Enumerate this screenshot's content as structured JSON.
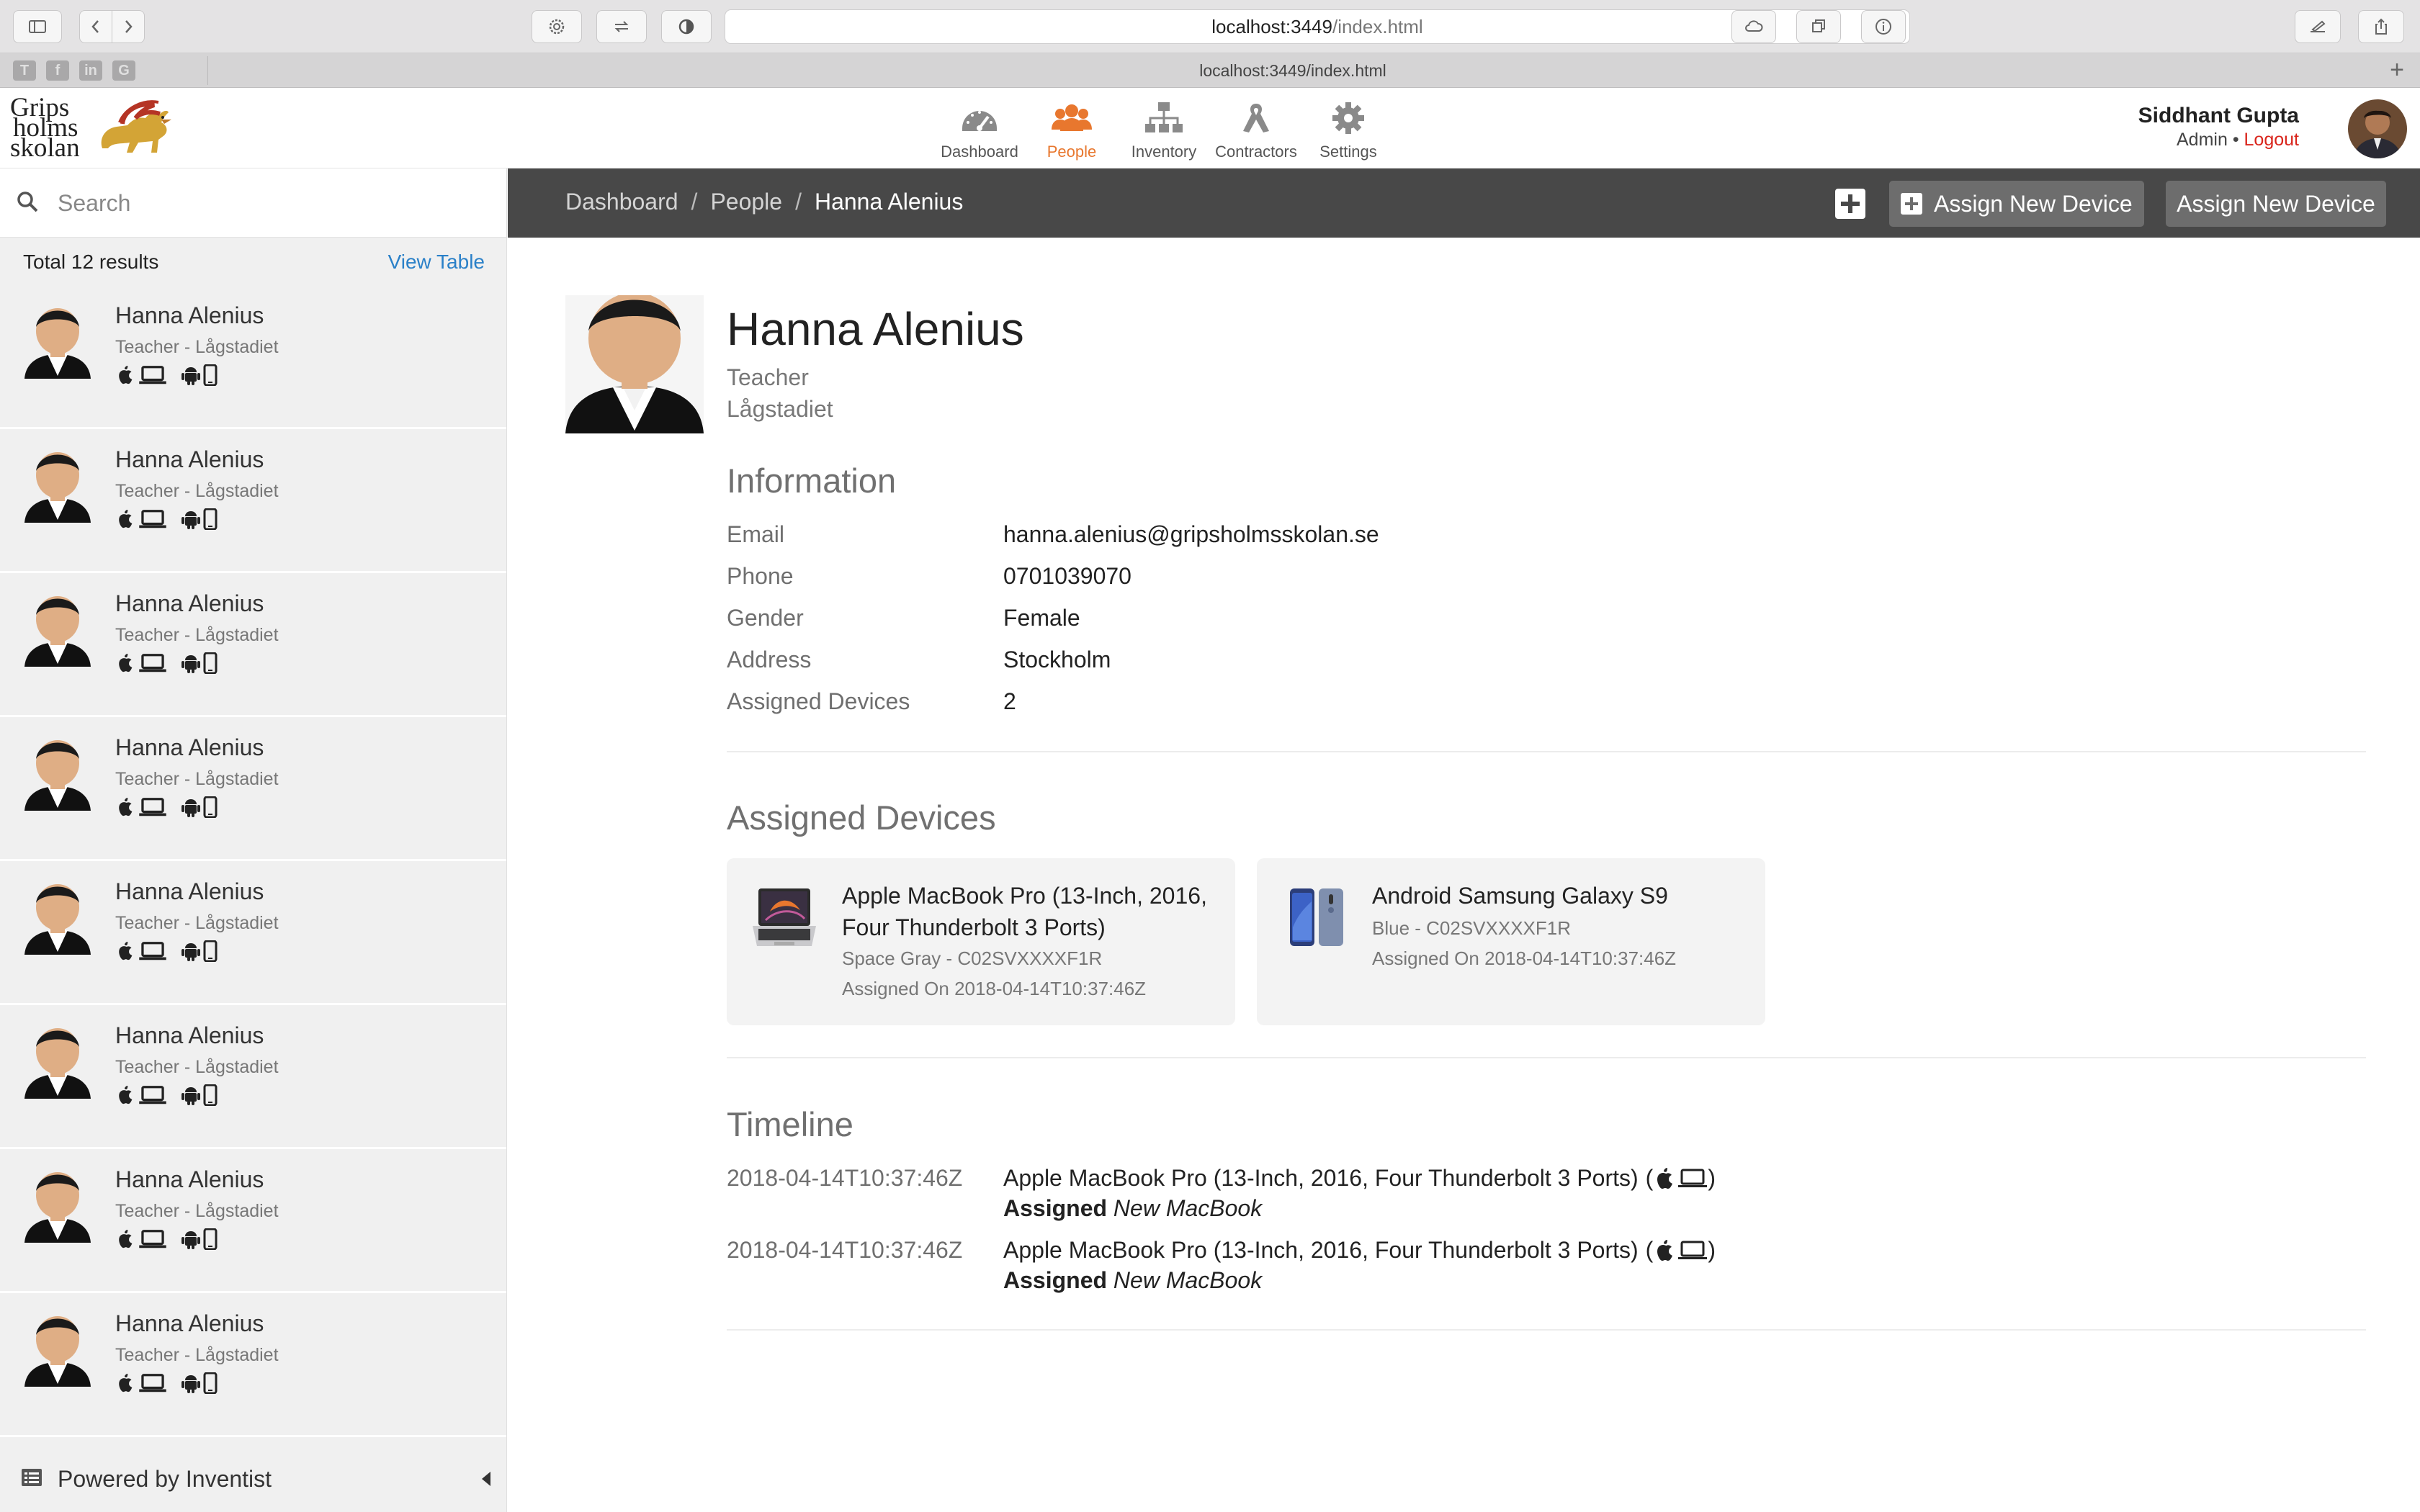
{
  "browser": {
    "url_host": "localhost:3449",
    "url_path": "/index.html",
    "tab_title": "localhost:3449/index.html",
    "favorites": [
      "T",
      "f",
      "in",
      "G"
    ]
  },
  "app": {
    "logo_lines": [
      "Grips",
      "holms",
      "skolan"
    ],
    "nav": [
      {
        "label": "Dashboard",
        "icon": "dashboard-icon",
        "active": false
      },
      {
        "label": "People",
        "icon": "people-icon",
        "active": true
      },
      {
        "label": "Inventory",
        "icon": "inventory-icon",
        "active": false
      },
      {
        "label": "Contractors",
        "icon": "contractors-icon",
        "active": false
      },
      {
        "label": "Settings",
        "icon": "settings-icon",
        "active": false
      }
    ],
    "accent_color": "#e8772e",
    "user": {
      "name": "Siddhant Gupta",
      "role": "Admin",
      "separator": "•",
      "logout": "Logout"
    }
  },
  "sidebar": {
    "search_placeholder": "Search",
    "total_label": "Total 12 results",
    "view_table": "View Table",
    "people": [
      {
        "name": "Hanna Alenius",
        "role": "Teacher - Lågstadiet"
      },
      {
        "name": "Hanna Alenius",
        "role": "Teacher - Lågstadiet"
      },
      {
        "name": "Hanna Alenius",
        "role": "Teacher - Lågstadiet"
      },
      {
        "name": "Hanna Alenius",
        "role": "Teacher - Lågstadiet"
      },
      {
        "name": "Hanna Alenius",
        "role": "Teacher - Lågstadiet"
      },
      {
        "name": "Hanna Alenius",
        "role": "Teacher - Lågstadiet"
      },
      {
        "name": "Hanna Alenius",
        "role": "Teacher - Lågstadiet"
      },
      {
        "name": "Hanna Alenius",
        "role": "Teacher - Lågstadiet"
      }
    ],
    "device_icons": [
      "apple-icon",
      "laptop-icon",
      "android-icon",
      "phone-icon"
    ],
    "powered_by": "Powered by Inventist"
  },
  "breadcrumb": {
    "items": [
      "Dashboard",
      "People"
    ],
    "current": "Hanna Alenius",
    "separator": "/"
  },
  "actions": {
    "assign_with_icon": "Assign New Device",
    "assign_plain": "Assign New Device"
  },
  "profile": {
    "name": "Hanna Alenius",
    "title": "Teacher",
    "department": "Lågstadiet",
    "information_heading": "Information",
    "info": [
      {
        "key": "Email",
        "value": "hanna.alenius@gripsholmsskolan.se"
      },
      {
        "key": "Phone",
        "value": "0701039070"
      },
      {
        "key": "Gender",
        "value": "Female"
      },
      {
        "key": "Address",
        "value": "Stockholm"
      },
      {
        "key": "Assigned Devices",
        "value": "2"
      }
    ],
    "devices_heading": "Assigned Devices",
    "devices": [
      {
        "title": "Apple MacBook Pro (13-Inch, 2016, Four Thunderbolt 3 Ports)",
        "detail": "Space Gray - C02SVXXXXF1R",
        "assigned": "Assigned On 2018-04-14T10:37:46Z"
      },
      {
        "title": "Android Samsung Galaxy S9",
        "detail": "Blue - C02SVXXXXF1R",
        "assigned": "Assigned On 2018-04-14T10:37:46Z"
      }
    ],
    "timeline_heading": "Timeline",
    "timeline": [
      {
        "time": "2018-04-14T10:37:46Z",
        "title": "Apple MacBook Pro (13-Inch, 2016, Four Thunderbolt 3 Ports)",
        "action": "Assigned",
        "item": "New MacBook"
      },
      {
        "time": "2018-04-14T10:37:46Z",
        "title": "Apple MacBook Pro (13-Inch, 2016, Four Thunderbolt 3 Ports)",
        "action": "Assigned",
        "item": "New MacBook"
      }
    ]
  }
}
